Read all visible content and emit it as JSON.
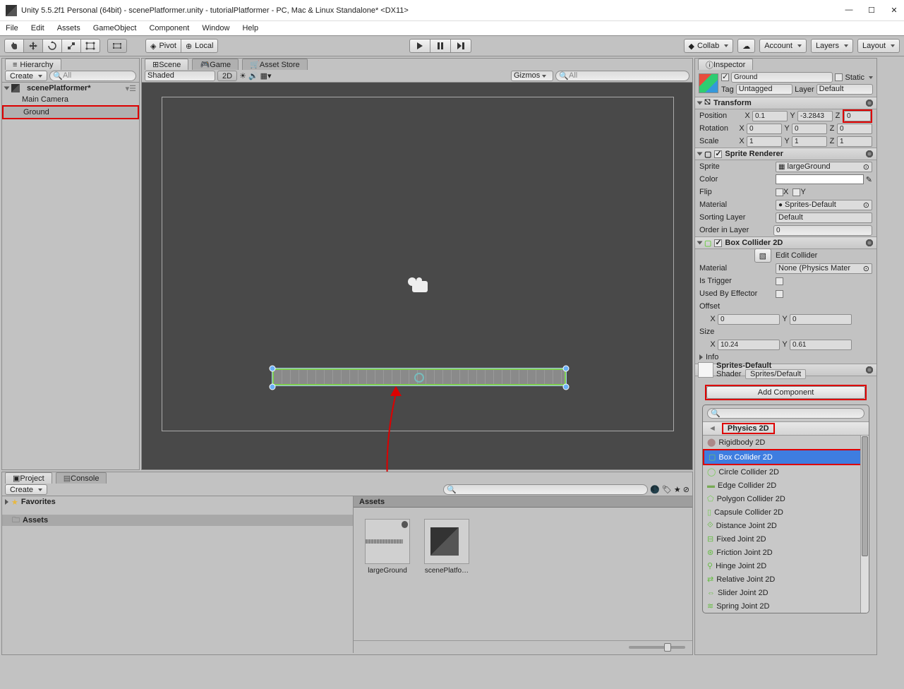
{
  "window": {
    "title": "Unity 5.5.2f1 Personal (64bit) - scenePlatformer.unity - tutorialPlatformer - PC, Mac & Linux Standalone* <DX11>"
  },
  "menu": [
    "File",
    "Edit",
    "Assets",
    "GameObject",
    "Component",
    "Window",
    "Help"
  ],
  "toolstrip": {
    "pivot": "Pivot",
    "local": "Local",
    "collab": "Collab",
    "account": "Account",
    "layers": "Layers",
    "layout": "Layout"
  },
  "hierarchy": {
    "tab": "Hierarchy",
    "create": "Create",
    "search": "All",
    "scene": "scenePlatformer*",
    "items": [
      "Main Camera",
      "Ground"
    ]
  },
  "scene": {
    "tabs": [
      "Scene",
      "Game",
      "Asset Store"
    ],
    "shaded": "Shaded",
    "twoD": "2D",
    "gizmos": "Gizmos",
    "search": "All"
  },
  "project": {
    "tab": "Project",
    "console": "Console",
    "create": "Create",
    "favorites": "Favorites",
    "assets": "Assets",
    "assetsHeader": "Assets",
    "items": [
      "largeGround",
      "scenePlatfo…"
    ]
  },
  "inspector": {
    "tab": "Inspector",
    "name": "Ground",
    "static": "Static",
    "tagLabel": "Tag",
    "tag": "Untagged",
    "layerLabel": "Layer",
    "layer": "Default",
    "transform": {
      "title": "Transform",
      "pos": {
        "x": "0.1",
        "y": "-3.2843",
        "z": "0"
      },
      "rot": {
        "x": "0",
        "y": "0",
        "z": "0"
      },
      "scale": {
        "x": "1",
        "y": "1",
        "z": "1"
      },
      "posL": "Position",
      "rotL": "Rotation",
      "scaleL": "Scale"
    },
    "sprite": {
      "title": "Sprite Renderer",
      "spriteL": "Sprite",
      "sprite": "largeGround",
      "colorL": "Color",
      "flipL": "Flip",
      "matL": "Material",
      "mat": "Sprites-Default",
      "sortL": "Sorting Layer",
      "sort": "Default",
      "orderL": "Order in Layer",
      "order": "0"
    },
    "box": {
      "title": "Box Collider 2D",
      "editL": "Edit Collider",
      "matL": "Material",
      "mat": "None (Physics Mater",
      "trigL": "Is Trigger",
      "effL": "Used By Effector",
      "offsetL": "Offset",
      "ox": "0",
      "oy": "0",
      "sizeL": "Size",
      "sx": "10.24",
      "sy": "0.61",
      "infoL": "Info"
    },
    "shader": {
      "name": "Sprites-Default",
      "shaderL": "Shader",
      "shader": "Sprites/Default"
    }
  },
  "addComp": {
    "button": "Add Component",
    "header": "Physics 2D",
    "items": [
      "Rigidbody 2D",
      "Box Collider 2D",
      "Circle Collider 2D",
      "Edge Collider 2D",
      "Polygon Collider 2D",
      "Capsule Collider 2D",
      "Distance Joint 2D",
      "Fixed Joint 2D",
      "Friction Joint 2D",
      "Hinge Joint 2D",
      "Relative Joint 2D",
      "Slider Joint 2D",
      "Spring Joint 2D"
    ]
  }
}
